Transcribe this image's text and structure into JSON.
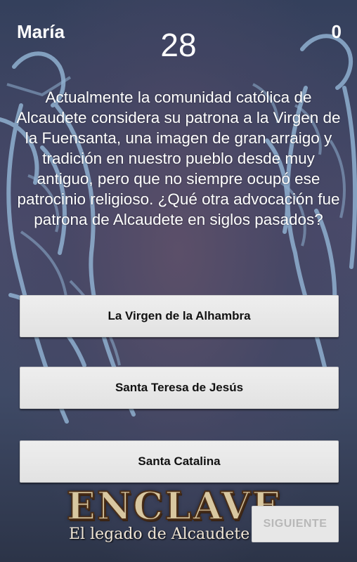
{
  "header": {
    "player_name": "María",
    "timer": "28",
    "score": "0"
  },
  "question": {
    "text": "Actualmente la comunidad católica de Alcaudete considera su patrona a la Virgen de la Fuensanta, una imagen de gran arraigo y tradición en nuestro pueblo desde muy antiguo, pero que no siempre ocupó ese patrocinio religioso. ¿Qué otra advocación fue patrona de Alcaudete en siglos pasados?"
  },
  "answers": [
    {
      "label": "La Virgen de la Alhambra"
    },
    {
      "label": "Santa Teresa de Jesús"
    },
    {
      "label": "Santa Catalina"
    }
  ],
  "logo": {
    "title": "ENCLAVE",
    "subtitle": "El legado de Alcaudete"
  },
  "next_button": {
    "label": "SIGUIENTE"
  },
  "colors": {
    "background": "#3d4a68",
    "figure_blue": "#8fb0d0",
    "button_bg": "#e6e6e6",
    "disabled_text": "#b8b8b8"
  }
}
